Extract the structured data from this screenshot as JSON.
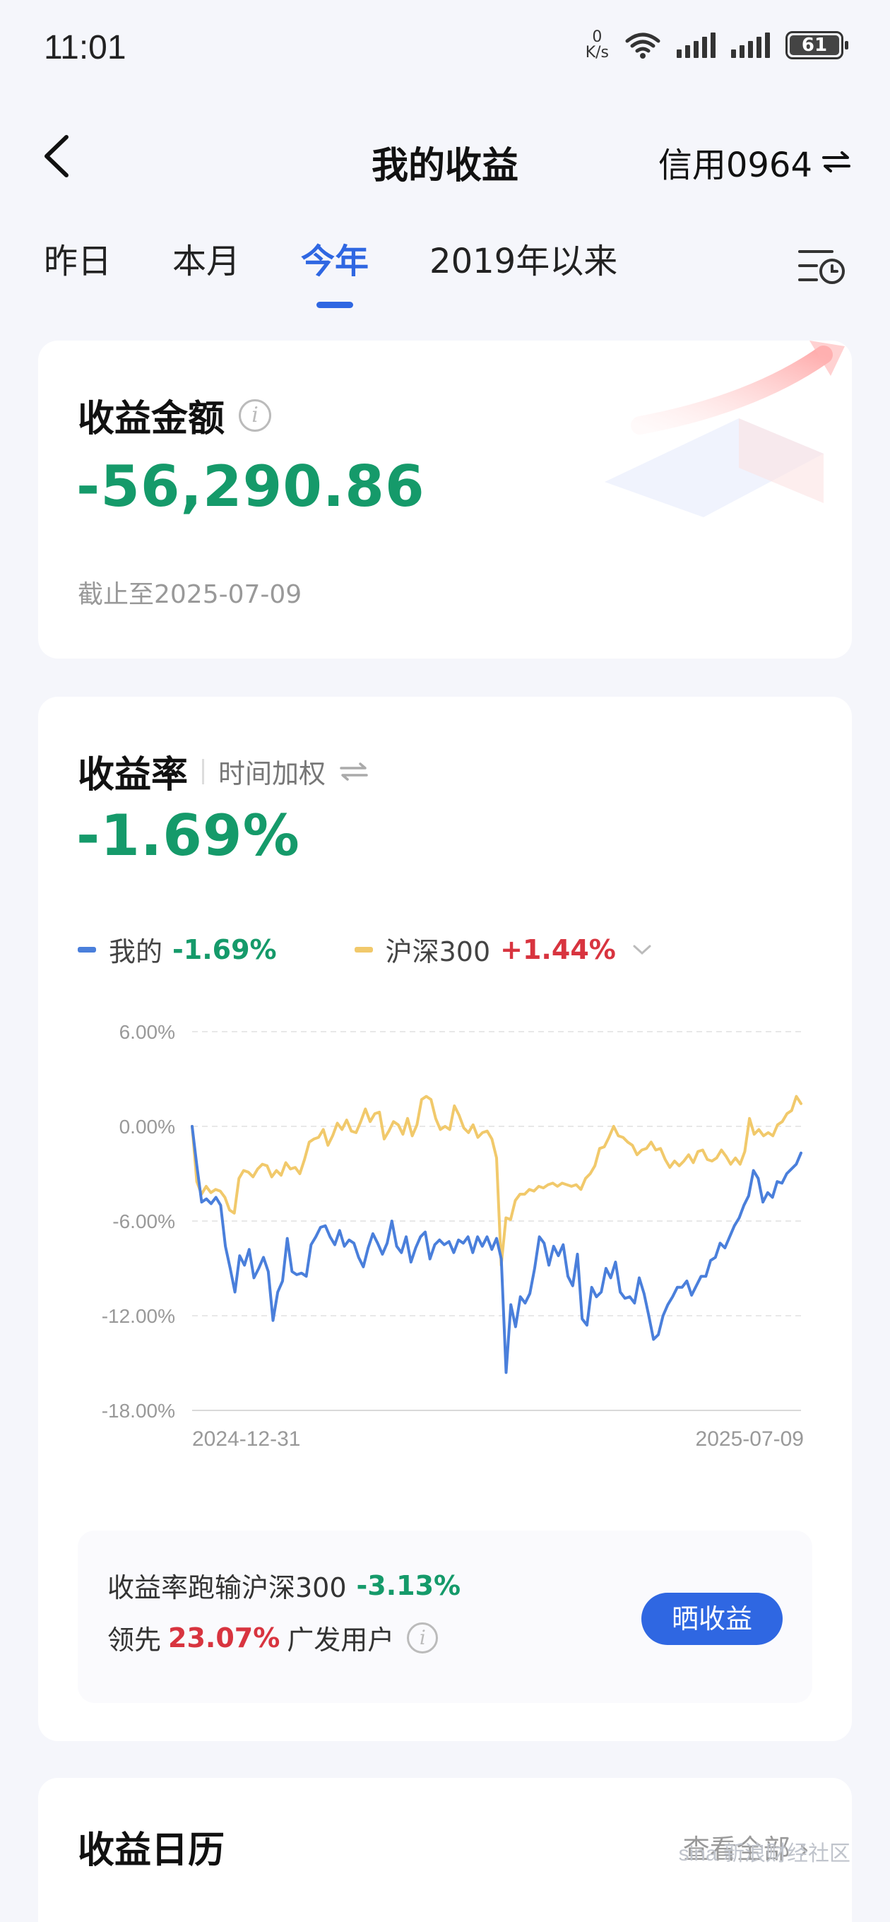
{
  "status": {
    "time": "11:01",
    "speed_value": "0",
    "speed_unit": "K/s",
    "battery": "61"
  },
  "header": {
    "title": "我的收益",
    "account": "信用0964"
  },
  "tabs": [
    {
      "label": "昨日",
      "active": false
    },
    {
      "label": "本月",
      "active": false
    },
    {
      "label": "今年",
      "active": true
    },
    {
      "label": "2019年以来",
      "active": false
    }
  ],
  "earnings": {
    "label": "收益金额",
    "value": "-56,290.86",
    "as_of": "截止至2025-07-09"
  },
  "rate": {
    "label": "收益率",
    "method": "时间加权",
    "value": "-1.69%",
    "legend": [
      {
        "name": "我的",
        "value": "-1.69%",
        "color": "#4a7fdb",
        "value_color": "#159a6a"
      },
      {
        "name": "沪深300",
        "value": "+1.44%",
        "color": "#f1c96b",
        "value_color": "#d8343f"
      }
    ]
  },
  "chart_data": {
    "type": "line",
    "x_start_label": "2024-12-31",
    "x_end_label": "2025-07-09",
    "ylim": [
      -18,
      6
    ],
    "yticks": [
      "6.00%",
      "0.00%",
      "-6.00%",
      "-12.00%",
      "-18.00%"
    ],
    "grid": true,
    "series": [
      {
        "name": "我的",
        "color": "#4a7fdb",
        "values": [
          0,
          -2.5,
          -4.8,
          -4.6,
          -4.9,
          -4.5,
          -5.0,
          -7.6,
          -9.0,
          -10.5,
          -8.2,
          -8.8,
          -7.8,
          -9.6,
          -9.0,
          -8.3,
          -9.2,
          -12.3,
          -10.5,
          -9.8,
          -7.1,
          -9.2,
          -9.4,
          -9.3,
          -9.5,
          -7.5,
          -7.0,
          -6.4,
          -6.3,
          -7.0,
          -7.5,
          -6.6,
          -7.6,
          -7.2,
          -7.4,
          -8.3,
          -8.9,
          -7.7,
          -6.8,
          -7.4,
          -8.1,
          -7.4,
          -6.0,
          -7.6,
          -8.0,
          -7.0,
          -8.6,
          -7.7,
          -7.0,
          -6.7,
          -8.4,
          -7.5,
          -7.2,
          -7.5,
          -7.3,
          -8.0,
          -7.2,
          -7.4,
          -7.0,
          -8.0,
          -7.0,
          -7.6,
          -7.0,
          -7.8,
          -7.1,
          -8.4,
          -15.6,
          -11.3,
          -12.7,
          -10.8,
          -11.2,
          -10.6,
          -9.0,
          -7.0,
          -7.4,
          -8.8,
          -7.6,
          -8.2,
          -7.5,
          -9.5,
          -10.1,
          -8.1,
          -12.2,
          -12.6,
          -10.2,
          -10.8,
          -10.5,
          -9.0,
          -9.6,
          -8.6,
          -10.5,
          -10.9,
          -10.8,
          -11.2,
          -9.6,
          -10.6,
          -12.0,
          -13.5,
          -13.2,
          -12.0,
          -11.3,
          -10.8,
          -10.2,
          -10.2,
          -9.8,
          -10.7,
          -10.1,
          -9.5,
          -9.5,
          -8.5,
          -8.3,
          -7.4,
          -7.7,
          -7.0,
          -6.3,
          -5.8,
          -5.0,
          -4.4,
          -2.8,
          -3.3,
          -4.8,
          -4.2,
          -4.5,
          -3.5,
          -3.6,
          -3.0,
          -2.7,
          -2.4,
          -1.69
        ]
      },
      {
        "name": "沪深300",
        "color": "#f1c96b",
        "values": [
          0,
          -3.5,
          -4.3,
          -3.8,
          -4.2,
          -4.0,
          -4.1,
          -4.5,
          -5.3,
          -5.5,
          -3.3,
          -2.8,
          -2.9,
          -3.2,
          -2.7,
          -2.4,
          -2.5,
          -3.2,
          -2.8,
          -3.1,
          -2.3,
          -2.7,
          -2.6,
          -3.0,
          -2.1,
          -1.0,
          -0.8,
          -0.7,
          -0.2,
          -1.2,
          -0.6,
          0.2,
          -0.2,
          0.4,
          -0.3,
          -0.4,
          0.3,
          1.1,
          0.3,
          0.8,
          0.9,
          -0.8,
          -0.3,
          0.3,
          0.1,
          -0.5,
          0.5,
          -0.6,
          0.1,
          1.7,
          1.9,
          1.7,
          0.5,
          -0.2,
          0.0,
          -0.2,
          1.3,
          0.7,
          -0.1,
          -0.4,
          0.1,
          -0.7,
          -0.4,
          -0.3,
          -0.8,
          -2.0,
          -8.8,
          -5.8,
          -5.9,
          -4.7,
          -4.3,
          -4.3,
          -4.0,
          -4.1,
          -3.8,
          -3.9,
          -3.7,
          -3.6,
          -3.8,
          -3.6,
          -3.7,
          -3.8,
          -3.7,
          -4.0,
          -3.3,
          -3.0,
          -2.5,
          -1.4,
          -1.3,
          -0.7,
          0.0,
          -0.6,
          -0.7,
          -1.0,
          -1.2,
          -1.8,
          -1.5,
          -1.4,
          -1.0,
          -1.5,
          -1.4,
          -2.1,
          -2.6,
          -2.2,
          -2.5,
          -2.2,
          -1.8,
          -2.3,
          -1.6,
          -1.5,
          -2.1,
          -2.2,
          -2.0,
          -1.5,
          -1.9,
          -2.4,
          -2.0,
          -2.4,
          -1.6,
          0.5,
          -0.5,
          -0.2,
          -0.6,
          -0.4,
          -0.6,
          0.1,
          0.3,
          0.8,
          1.0,
          1.9,
          1.44
        ]
      }
    ]
  },
  "summary": {
    "line1_text": "收益率跑输沪深300",
    "line1_value": "-3.13%",
    "line2_prefix": "领先",
    "line2_value": "23.07%",
    "line2_suffix": "广发用户",
    "share_button": "晒收益"
  },
  "calendar": {
    "title": "收益日历",
    "view_all": "查看全部 ›"
  },
  "watermark": "sina 新浪财经社区"
}
